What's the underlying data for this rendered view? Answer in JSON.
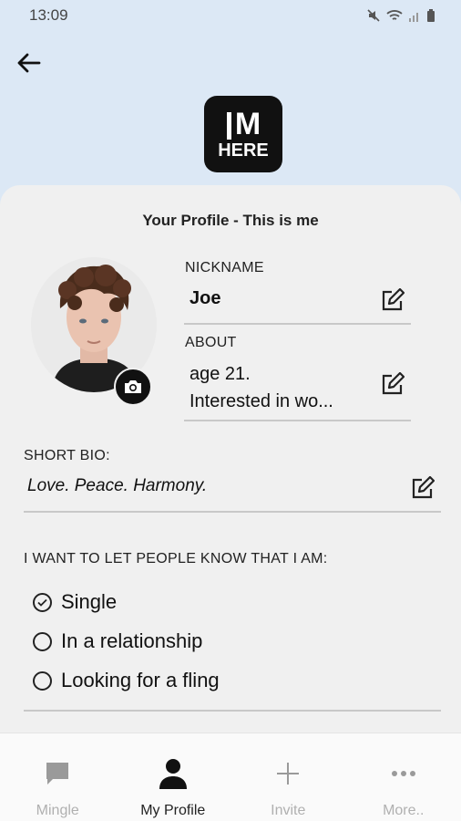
{
  "status_bar": {
    "time": "13:09"
  },
  "logo": {
    "line1": "M",
    "line2": "HERE"
  },
  "card": {
    "title": "Your Profile - This is me"
  },
  "nickname": {
    "label": "NICKNAME",
    "value": "Joe"
  },
  "about": {
    "label": "ABOUT",
    "line1": "age 21.",
    "line2": "Interested in wo..."
  },
  "bio": {
    "label": "SHORT BIO:",
    "value": "Love. Peace. Harmony."
  },
  "relationship": {
    "label": "I WANT TO LET PEOPLE KNOW THAT I AM:",
    "options": [
      {
        "label": "Single",
        "checked": true
      },
      {
        "label": "In a relationship",
        "checked": false
      },
      {
        "label": "Looking for a fling",
        "checked": false
      }
    ]
  },
  "nav": {
    "items": [
      {
        "label": "Mingle",
        "icon": "chat-bubble-icon",
        "active": false
      },
      {
        "label": "My Profile",
        "icon": "person-icon",
        "active": true
      },
      {
        "label": "Invite",
        "icon": "plus-icon",
        "active": false
      },
      {
        "label": "More..",
        "icon": "more-dots-icon",
        "active": false
      }
    ]
  }
}
